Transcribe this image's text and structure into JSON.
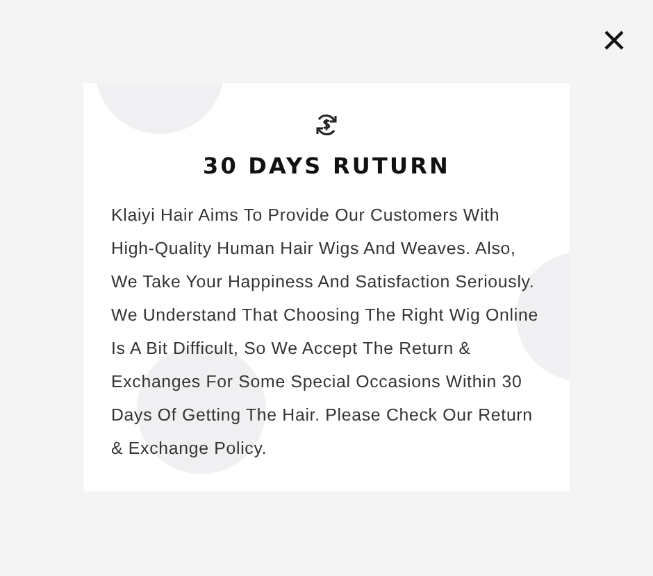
{
  "dialog": {
    "title": "30 DAYS RUTURN",
    "body": "Klaiyi Hair Aims To Provide Our Customers With High-Quality Human Hair Wigs And Weaves. Also, We Take Your Happiness And Satisfaction Seriously. We Understand That Choosing The Right Wig Online Is A Bit Difficult, So We Accept The Return & Exchanges For Some Special Occasions Within 30 Days Of Getting The Hair. Please Check Our Return & Exchange Policy."
  }
}
